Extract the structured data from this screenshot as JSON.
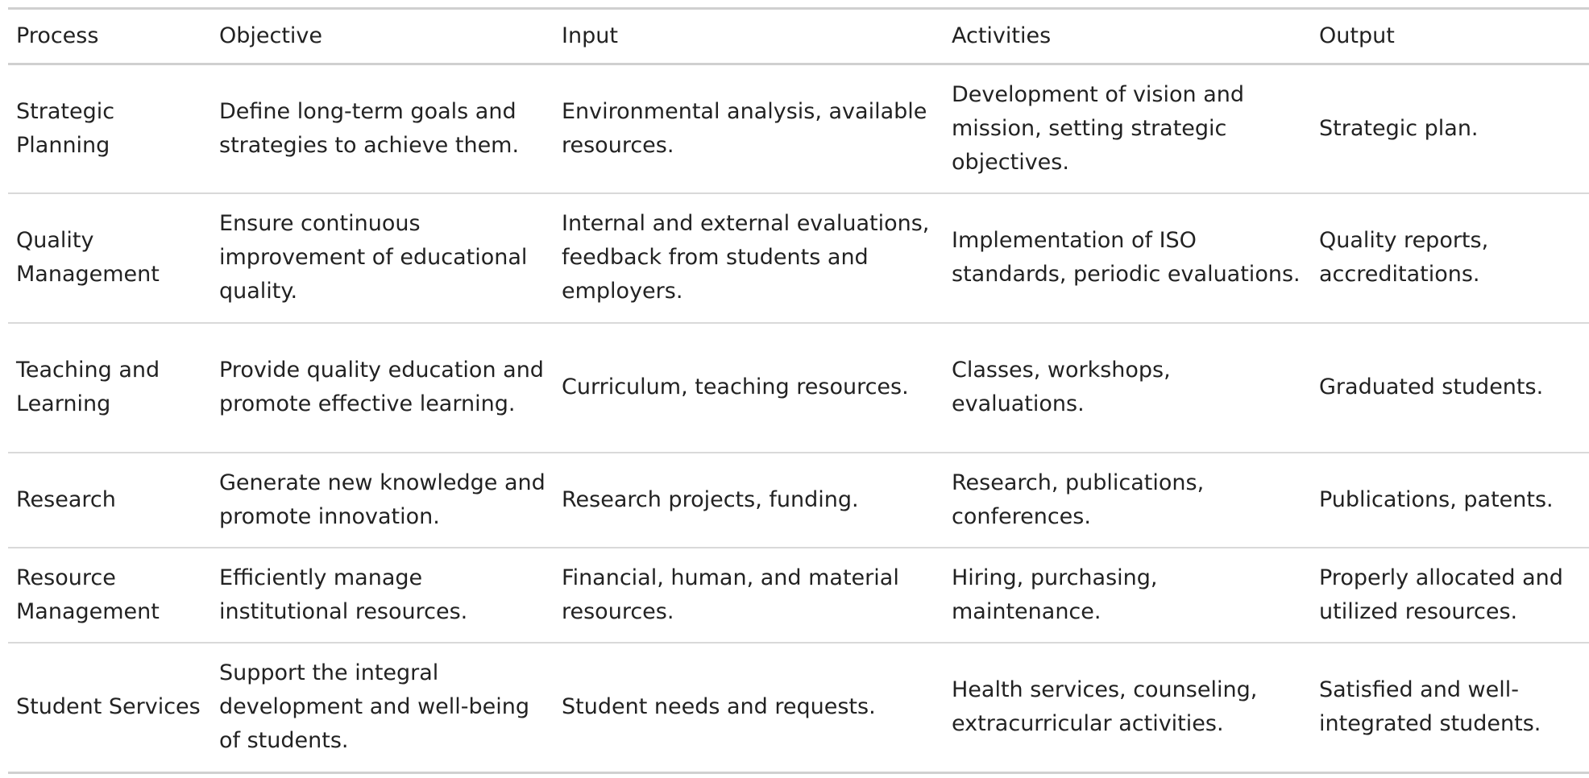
{
  "table": {
    "headers": [
      "Process",
      "Objective",
      "Input",
      "Activities",
      "Output"
    ],
    "rows": [
      {
        "process": "Strategic Planning",
        "objective": "Define long-term goals and strategies to achieve them.",
        "input": "Environmental analysis, available resources.",
        "activities": "Development of vision and mission, setting strategic objectives.",
        "output": "Strategic plan."
      },
      {
        "process": "Quality Management",
        "objective": "Ensure continuous improvement of educational quality.",
        "input": "Internal and external evaluations, feedback from students and employers.",
        "activities": "Implementation of ISO standards, periodic evaluations.",
        "output": "Quality reports, accreditations."
      },
      {
        "process": "Teaching and Learning",
        "objective": "Provide quality education and promote effective learning.",
        "input": "Curriculum, teaching resources.",
        "activities": "Classes, workshops, evaluations.",
        "output": "Graduated students."
      },
      {
        "process": "Research",
        "objective": "Generate new knowledge and promote innovation.",
        "input": "Research projects, funding.",
        "activities": "Research, publications, conferences.",
        "output": "Publications, patents."
      },
      {
        "process": "Resource Management",
        "objective": "Efficiently manage institutional resources.",
        "input": "Financial, human, and material resources.",
        "activities": "Hiring, purchasing, maintenance.",
        "output": "Properly allocated and utilized resources."
      },
      {
        "process": "Student Services",
        "objective": "Support the integral development and well-being of students.",
        "input": "Student needs and requests.",
        "activities": "Health services, counseling, extracurricular activities.",
        "output": "Satisfied and well-integrated students."
      }
    ]
  }
}
